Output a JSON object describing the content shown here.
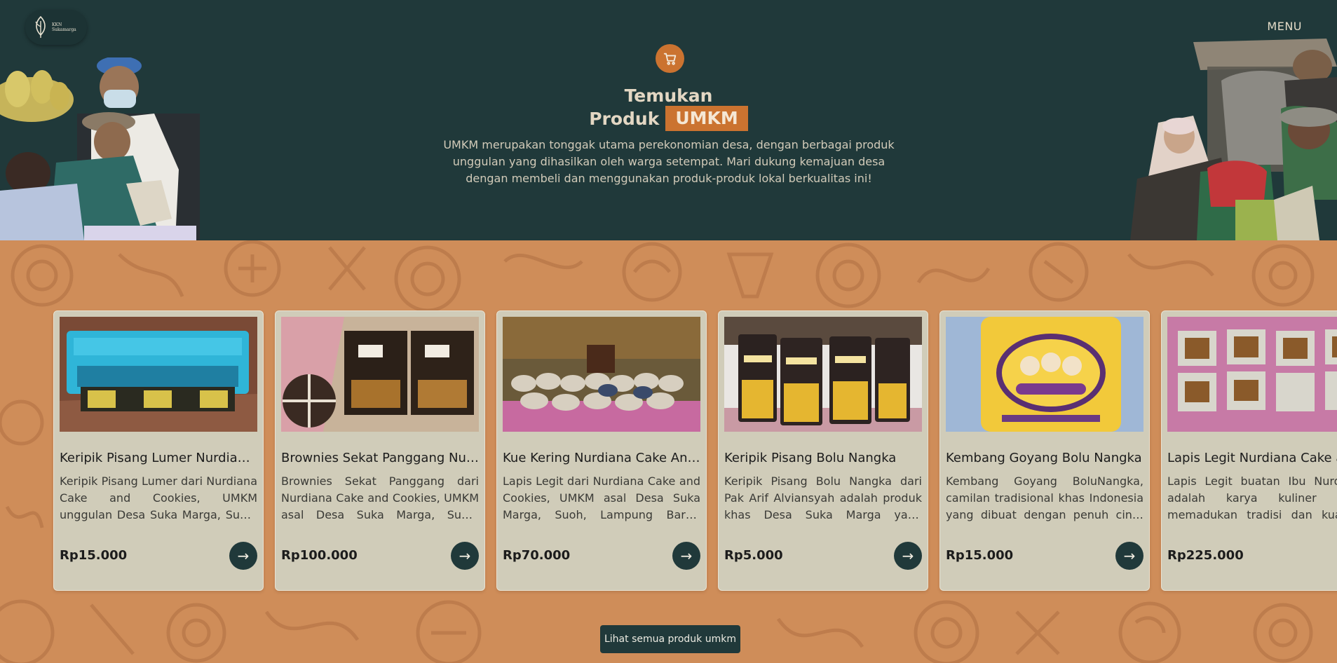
{
  "header": {
    "logo_text": [
      "KKN",
      "Sukamarga"
    ],
    "menu_label": "MENU"
  },
  "hero": {
    "icon": "cart-icon",
    "title_line1": "Temukan",
    "title_word": "Produk",
    "title_highlight": "UMKM",
    "description": "UMKM merupakan tonggak utama perekonomian desa, dengan berbagai produk unggulan yang dihasilkan oleh warga setempat. Mari dukung kemajuan desa dengan membeli dan menggunakan produk-produk lokal berkualitas ini!"
  },
  "products": [
    {
      "name": "Keripik Pisang Lumer Nurdiana Cake And Cookies",
      "description": "Keripik Pisang Lumer dari Nurdiana Cake and Cookies, UMKM unggulan Desa Suka Marga, Suoh, Lampung Barat, adalah camilan renyah dan lezat.",
      "price": "Rp15.000"
    },
    {
      "name": "Brownies Sekat Panggang Nurdiana Cake And Cookies",
      "description": "Brownies Sekat Panggang dari Nurdiana Cake and Cookies, UMKM asal Desa Suka Marga, Suoh, Lampung Barat, hadir dengan rasa istimewa.",
      "price": "Rp100.000"
    },
    {
      "name": "Kue Kering Nurdiana Cake And Cookies",
      "description": "Lapis Legit dari Nurdiana Cake and Cookies, UMKM asal Desa Suka Marga, Suoh, Lampung Barat, adalah sajian manis penuh cita rasa.",
      "price": "Rp70.000"
    },
    {
      "name": "Keripik Pisang Bolu Nangka",
      "description": "Keripik Pisang Bolu Nangka dari Pak Arif Alviansyah adalah produk khas Desa Suka Marga yang memadukan rasa dan tekstur terbaik.",
      "price": "Rp5.000"
    },
    {
      "name": "Kembang Goyang Bolu Nangka",
      "description": "Kembang Goyang BoluNangka, camilan tradisional khas Indonesia yang dibuat dengan penuh cinta dan resep turun-temurun.",
      "price": "Rp15.000"
    },
    {
      "name": "Lapis Legit Nurdiana Cake and Cookies",
      "description": "Lapis Legit buatan Ibu Nurdiana adalah karya kuliner yang memadukan tradisi dan kualitas terbaik. Dengan bahan pilihan.",
      "price": "Rp225.000"
    }
  ],
  "see_all_label": "Lihat semua produk umkm",
  "colors": {
    "hero_bg": "#20393a",
    "accent": "#cb7330",
    "section_bg": "#cf8d59",
    "card_bg": "#d0ccb9"
  }
}
